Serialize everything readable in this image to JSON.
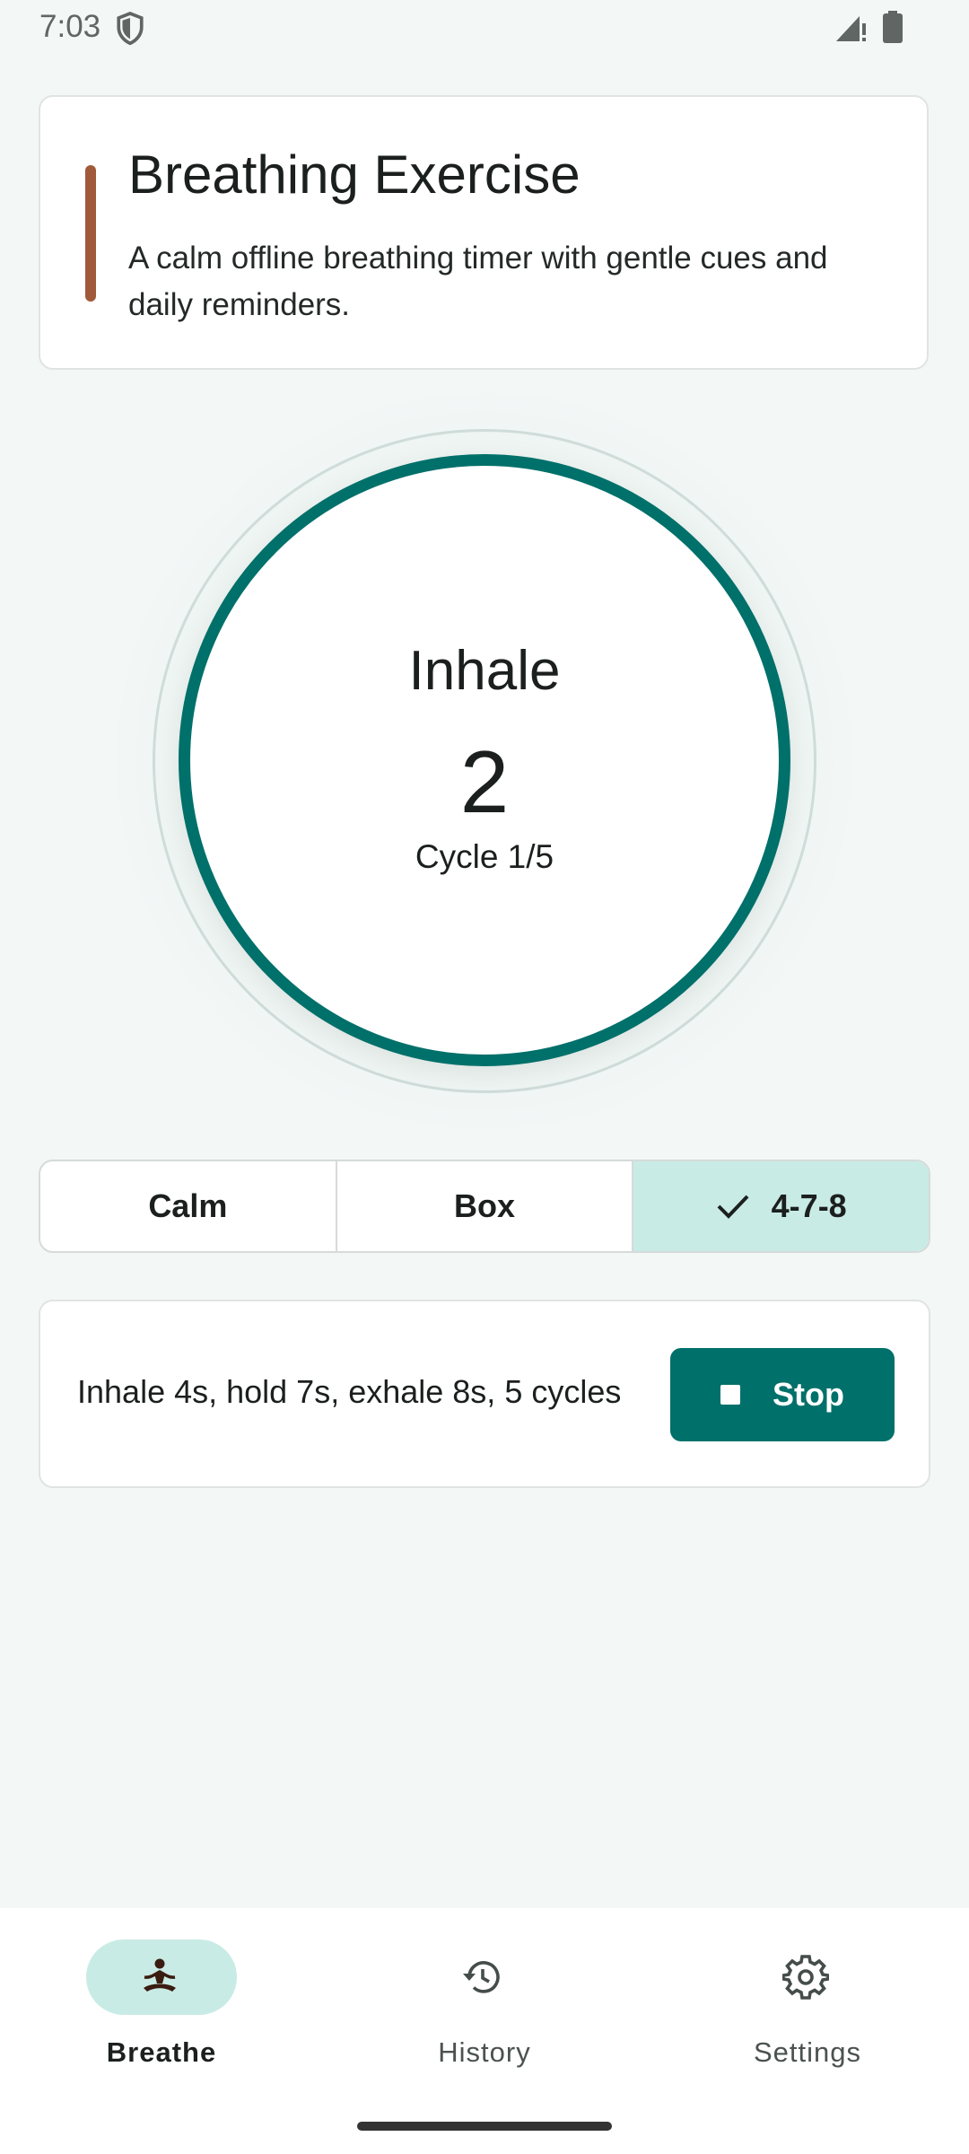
{
  "status_bar": {
    "time": "7:03",
    "icons": [
      "shield-icon",
      "signal-icon",
      "battery-icon"
    ]
  },
  "header": {
    "title": "Breathing Exercise",
    "subtitle": "A calm offline breathing timer with gentle cues and daily reminders.",
    "accent_color": "#a05a3a"
  },
  "timer": {
    "phase": "Inhale",
    "count": "2",
    "cycle": "Cycle 1/5",
    "ring_color": "#00706a"
  },
  "patterns": {
    "options": [
      "Calm",
      "Box",
      "4-7-8"
    ],
    "selected": "4-7-8",
    "selected_color": "#c9ebe5"
  },
  "session": {
    "description": "Inhale 4s, hold 7s, exhale 8s, 5 cycles",
    "stop_label": "Stop",
    "button_color": "#00706a"
  },
  "nav": {
    "items": [
      {
        "label": "Breathe",
        "icon": "meditation-icon",
        "active": true
      },
      {
        "label": "History",
        "icon": "history-icon",
        "active": false
      },
      {
        "label": "Settings",
        "icon": "gear-icon",
        "active": false
      }
    ]
  }
}
